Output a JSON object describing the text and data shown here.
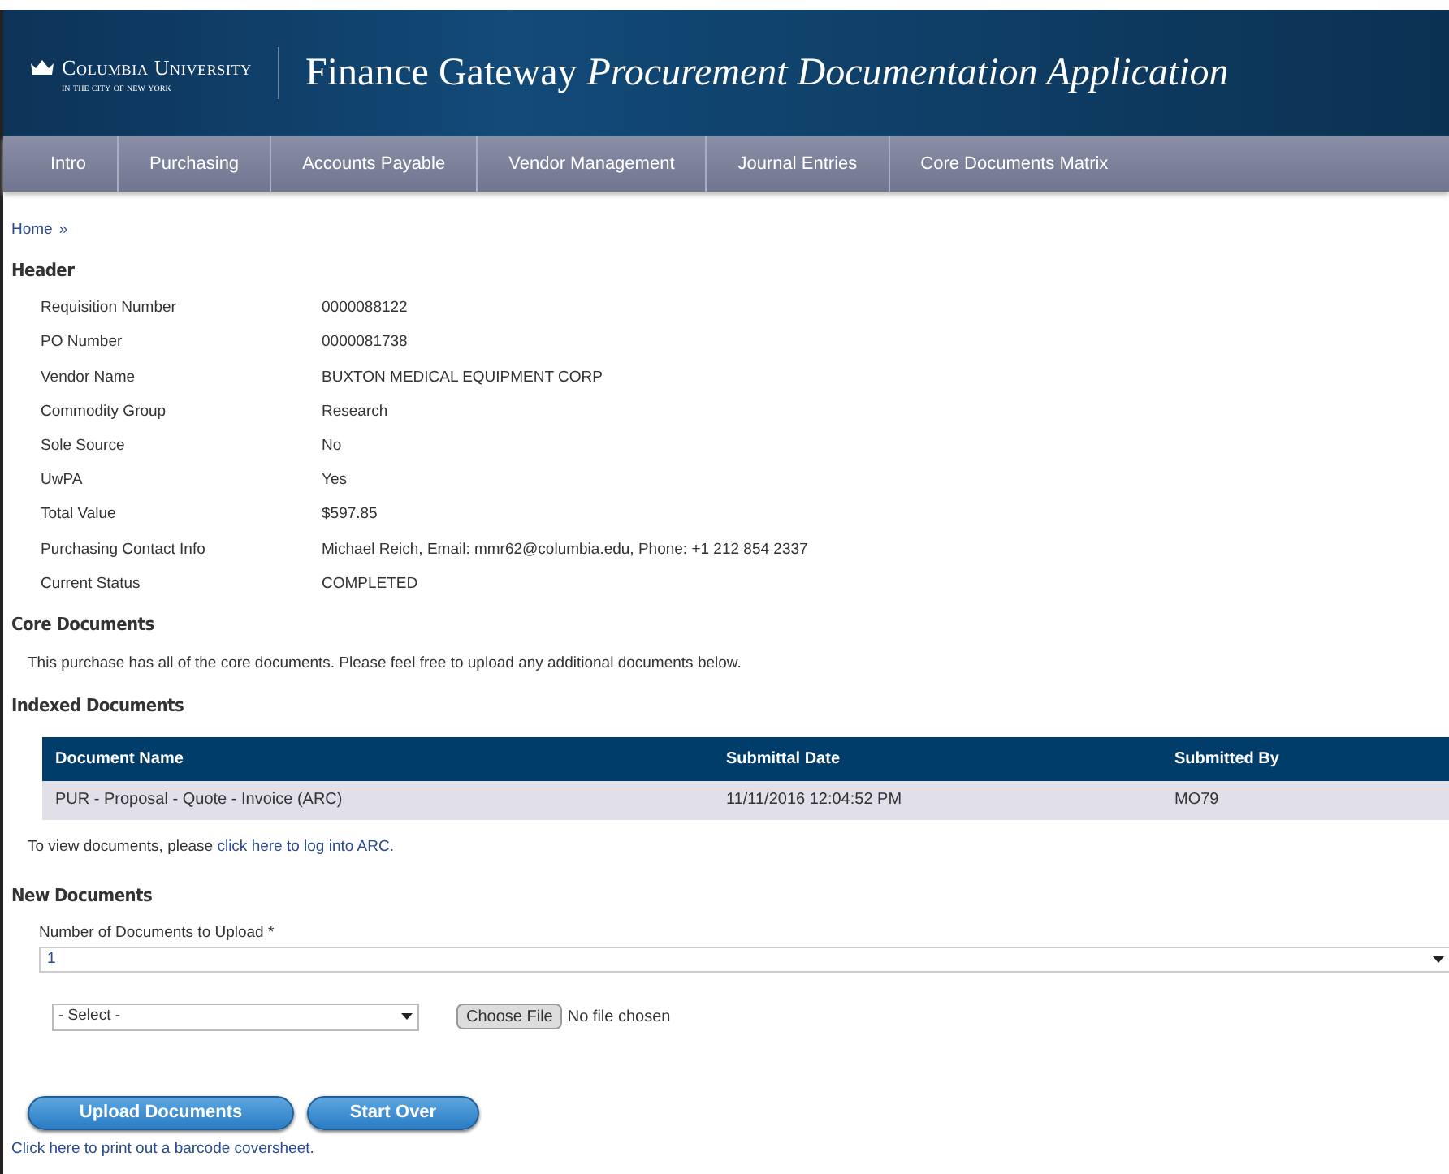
{
  "brand": {
    "line1": "Columbia University",
    "line2": "in the city of new york"
  },
  "app_title": {
    "main": "Finance Gateway",
    "sub": "Procurement Documentation Application"
  },
  "nav": [
    {
      "label": "Intro"
    },
    {
      "label": "Purchasing"
    },
    {
      "label": "Accounts Payable"
    },
    {
      "label": "Vendor Management"
    },
    {
      "label": "Journal Entries"
    },
    {
      "label": "Core Documents Matrix"
    }
  ],
  "breadcrumb": {
    "home": "Home",
    "separator": "»"
  },
  "header": {
    "title": "Header",
    "fields": [
      {
        "label": "Requisition Number",
        "value": "0000088122"
      },
      {
        "label": "PO Number",
        "value": "0000081738"
      },
      {
        "label": "Vendor Name",
        "value": "BUXTON MEDICAL EQUIPMENT CORP"
      },
      {
        "label": "Commodity Group",
        "value": "Research"
      },
      {
        "label": "Sole Source",
        "value": "No"
      },
      {
        "label": "UwPA",
        "value": "Yes"
      },
      {
        "label": "Total Value",
        "value": "$597.85"
      },
      {
        "label": "Purchasing Contact Info",
        "value": "Michael Reich, Email: mmr62@columbia.edu, Phone: +1 212 854 2337"
      },
      {
        "label": "Current Status",
        "value": "COMPLETED"
      }
    ]
  },
  "core_documents": {
    "title": "Core Documents",
    "message": "This purchase has all of the core documents. Please feel free to upload any additional documents below."
  },
  "indexed_documents": {
    "title": "Indexed Documents",
    "columns": [
      "Document Name",
      "Submittal Date",
      "Submitted By"
    ],
    "rows": [
      [
        "PUR - Proposal - Quote - Invoice (ARC)",
        "11/11/2016 12:04:52 PM",
        "MO79"
      ]
    ],
    "note": "To view documents, please ",
    "note_link": "click here to log into ARC."
  },
  "new_documents": {
    "title": "New Documents",
    "count_label": "Number of Documents to Upload *",
    "count_value": "1",
    "type_select": "- Select -",
    "file_button": "Choose File",
    "file_status": "No file chosen"
  },
  "buttons": [
    "Upload Documents",
    "Start Over"
  ],
  "footer_link": "Click here to print out a barcode coversheet."
}
